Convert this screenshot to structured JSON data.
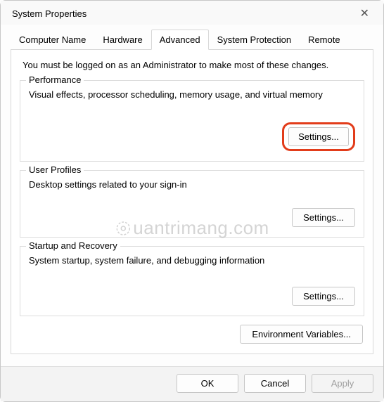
{
  "window": {
    "title": "System Properties"
  },
  "tabs": {
    "computer_name": "Computer Name",
    "hardware": "Hardware",
    "advanced": "Advanced",
    "system_protection": "System Protection",
    "remote": "Remote"
  },
  "intro": "You must be logged on as an Administrator to make most of these changes.",
  "groups": {
    "performance": {
      "legend": "Performance",
      "desc": "Visual effects, processor scheduling, memory usage, and virtual memory",
      "button": "Settings..."
    },
    "user_profiles": {
      "legend": "User Profiles",
      "desc": "Desktop settings related to your sign-in",
      "button": "Settings..."
    },
    "startup": {
      "legend": "Startup and Recovery",
      "desc": "System startup, system failure, and debugging information",
      "button": "Settings..."
    }
  },
  "env_button": "Environment Variables...",
  "bottom": {
    "ok": "OK",
    "cancel": "Cancel",
    "apply": "Apply"
  },
  "watermark": "uantrimang.com"
}
